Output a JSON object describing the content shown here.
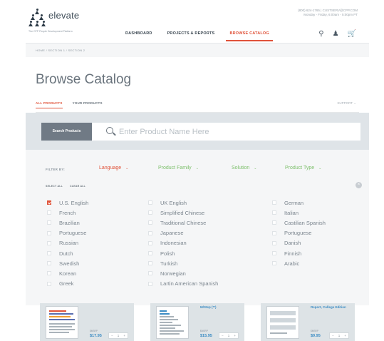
{
  "header": {
    "logo_name": "elevate",
    "logo_tag": "The CPP People Development Platform",
    "contact_line1": "(800) 624-1765 | CUSTSERV@CPP.COM",
    "contact_line2": "Monday - Friday, 6:00am - 5:00pm PT",
    "nav": [
      "DASHBOARD",
      "PROJECTS & REPORTS",
      "BROWSE CATALOG"
    ],
    "active_nav": "BROWSE CATALOG"
  },
  "breadcrumb": "HOME / SECTION 1 / SECTION 2",
  "page_title": "Browse Catalog",
  "tabs": [
    "ALL PRODUCTS",
    "YOUR PRODUCTS"
  ],
  "support": "SUPPORT",
  "search": {
    "button": "Search Products",
    "placeholder": "Enter Product Name Here"
  },
  "filters": {
    "label": "FILTER BY:",
    "dropdowns": [
      {
        "label": "Language",
        "color": "#e0533a"
      },
      {
        "label": "Product Family",
        "color": "#7cbf6a"
      },
      {
        "label": "Solution",
        "color": "#7cbf6a"
      },
      {
        "label": "Product Type",
        "color": "#7cbf6a"
      }
    ],
    "select_all": "SELECT ALL",
    "clear_all": "CLEAR ALL",
    "languages": {
      "col1": [
        "U.S. English",
        "French",
        "Brazilian",
        "Portuguese",
        "Russian",
        "Dutch",
        "Swedish",
        "Korean",
        "Greek"
      ],
      "col2": [
        "UK English",
        "Simplified Chinese",
        "Traditional Chinese",
        "Japanese",
        "Indonesian",
        "Polish",
        "Turkish",
        "Norwegian",
        "Lartin American Spanish"
      ],
      "col3": [
        "German",
        "Italian",
        "Castilian Spanish",
        "Portuguese",
        "Danish",
        "Finnish",
        "Arabic"
      ]
    },
    "checked": "U.S. English"
  },
  "products": [
    {
      "title": "",
      "price_label": "$MSRP",
      "price": "$17.95",
      "qty": "1"
    },
    {
      "title": "M/Step (**)",
      "price_label": "$MSRP",
      "price": "$15.95",
      "qty": "1"
    },
    {
      "title": "Report, College Edition",
      "price_label": "$MSRP",
      "price": "$9.95",
      "qty": "1"
    }
  ],
  "colors": {
    "accent": "#e0533a",
    "filter_green": "#7cbf6a",
    "link_blue": "#3c8cc4"
  }
}
